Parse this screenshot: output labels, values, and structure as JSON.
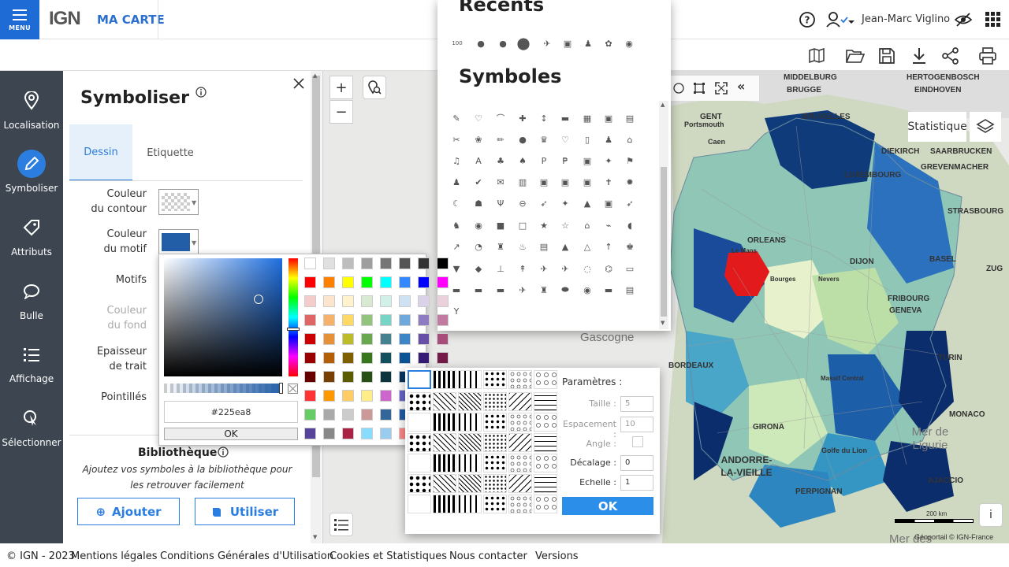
{
  "header": {
    "menu_label": "MENU",
    "logo": "IGN",
    "app_name": "MA CARTE",
    "user_name": "Jean-Marc Viglino"
  },
  "sidebar": {
    "items": [
      {
        "label": "Localisation",
        "icon": "location-pin-icon"
      },
      {
        "label": "Symboliser",
        "icon": "pencil-icon",
        "active": true
      },
      {
        "label": "Attributs",
        "icon": "tag-icon"
      },
      {
        "label": "Bulle",
        "icon": "speech-bubble-icon"
      },
      {
        "label": "Affichage",
        "icon": "list-icon"
      },
      {
        "label": "Sélectionner",
        "icon": "select-icon"
      }
    ]
  },
  "panel": {
    "title": "Symboliser",
    "tabs": [
      "Dessin",
      "Etiquette"
    ],
    "fields": {
      "contour_color": "Couleur\ndu contour",
      "motif_color": "Couleur\ndu motif",
      "motifs": "Motifs",
      "fond_color": "Couleur\ndu fond",
      "trait_width": "Epaisseur\nde trait",
      "dashes": "Pointillés"
    },
    "library": {
      "title": "Bibliothèque",
      "description": "Ajoutez vos symboles à la bibliothèque pour les retrouver facilement",
      "add_label": "Ajouter",
      "use_label": "Utiliser"
    }
  },
  "colorpicker": {
    "hex_value": "#225ea8",
    "ok_label": "OK",
    "current_color": "#225ea8"
  },
  "symbols_window": {
    "recents_title": "Recents",
    "symbols_title": "Symboles"
  },
  "pattern_window": {
    "title": "Paramètres :",
    "params": [
      {
        "label": "Taille :",
        "value": "5",
        "disabled": true
      },
      {
        "label": "Espacement :",
        "value": "10",
        "disabled": true
      },
      {
        "label": "Angle :",
        "value": "",
        "disabled": true
      },
      {
        "label": "Décalage :",
        "value": "0",
        "disabled": false
      },
      {
        "label": "Echelle :",
        "value": "1",
        "disabled": false
      }
    ],
    "ok_label": "OK"
  },
  "map": {
    "statistique_label": "Statistique",
    "labels": [
      "MIDDELBURG",
      "HERTOGENBOSCH",
      "BRUGGE",
      "EINDHOVEN",
      "BRUXELLES",
      "GENT",
      "Portsmouth",
      "Caen",
      "LUXEMBOURG",
      "DIEKIRCH",
      "SAARBRUCKEN",
      "GREVENMACHER",
      "STRASBOURG",
      "ORLEANS",
      "Le Mans",
      "Bourges",
      "Nevers",
      "DIJON",
      "BASEL",
      "ZUG",
      "FRIBOURG",
      "GENEVA",
      "Gascogne",
      "BORDEAUX",
      "TURIN",
      "MONACO",
      "ANDORRE-LA-VIEILLE",
      "Golfe du Lion",
      "Mer de Ligurie",
      "AJACCIO",
      "GIRONA",
      "PERPIGNAN",
      "Massif Central",
      "Mer des"
    ],
    "scale_label": "200 km",
    "attribution": "Géoportail © IGN-France"
  },
  "footer": {
    "copyright": "© IGN - 2023",
    "links": [
      "Mentions légales",
      "Conditions Générales d'Utilisation",
      "Cookies et Statistiques",
      "Nous contacter",
      "Versions"
    ]
  }
}
